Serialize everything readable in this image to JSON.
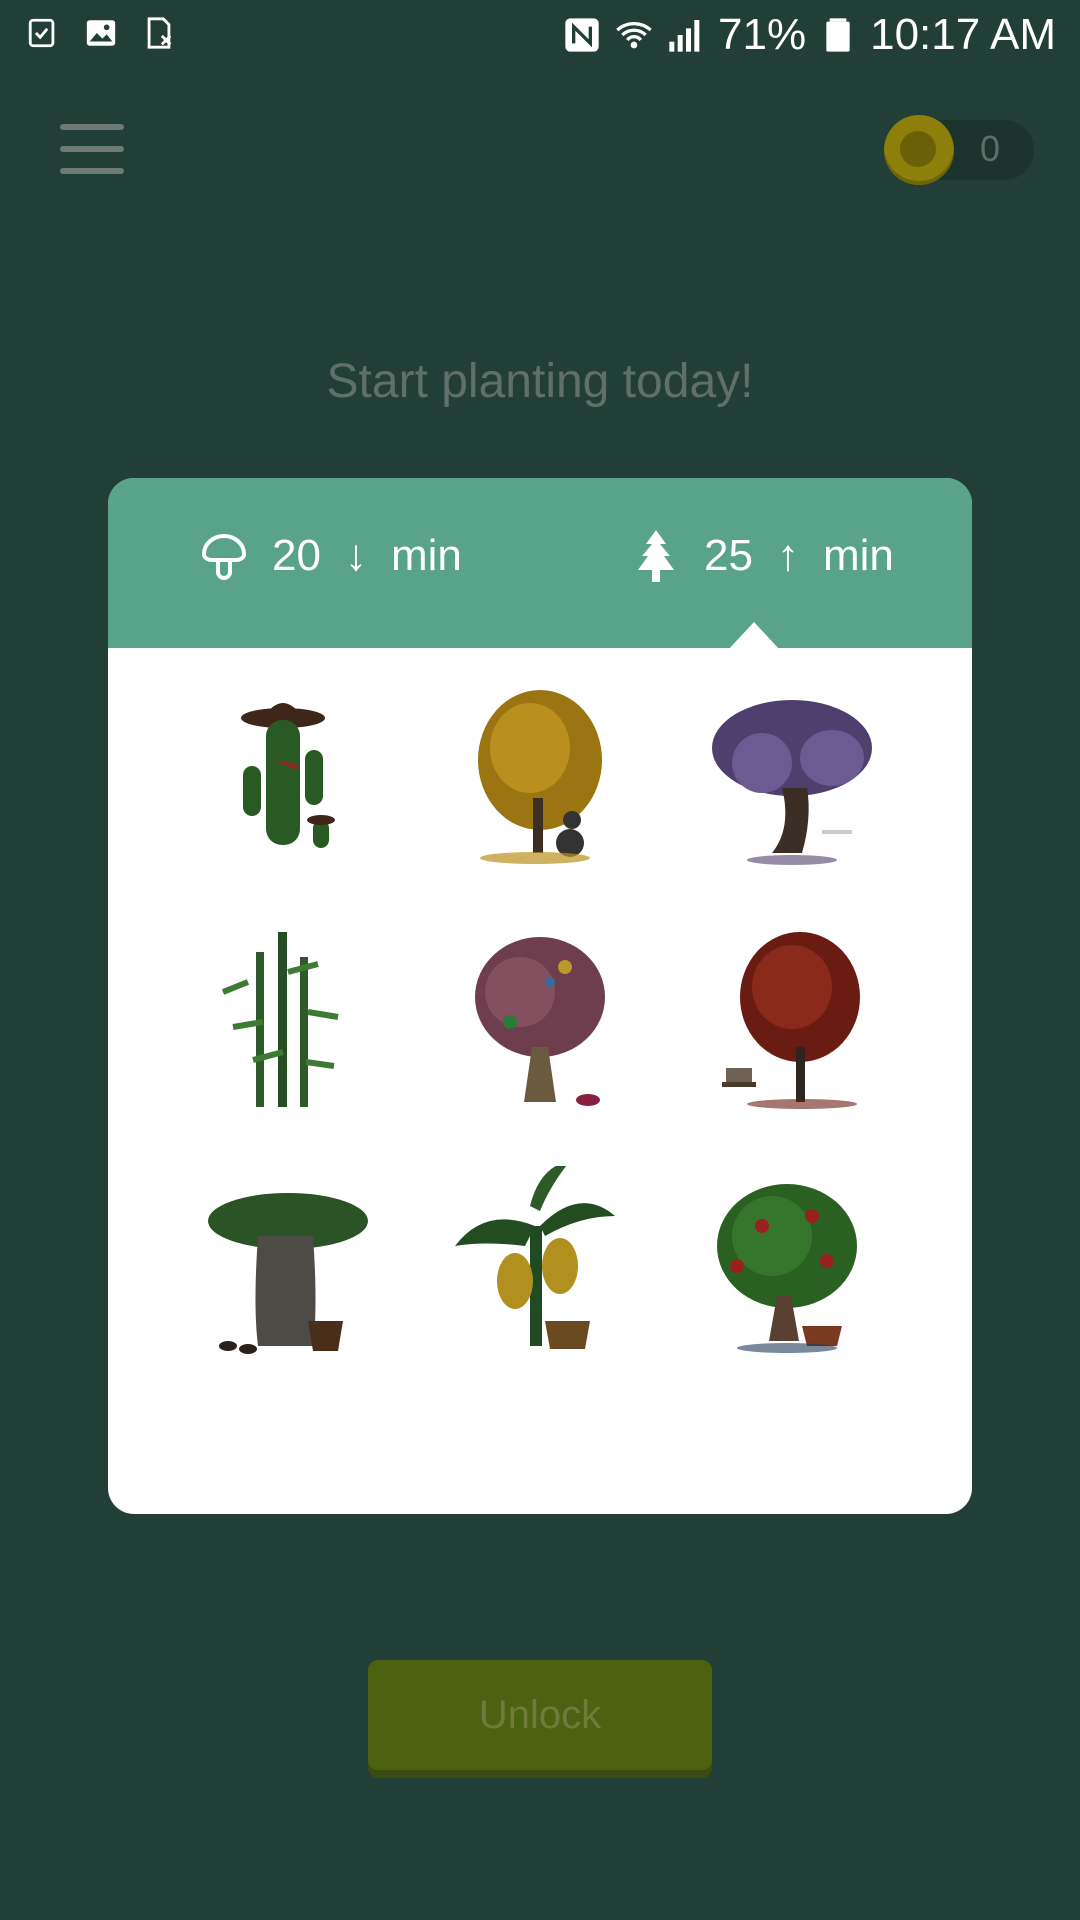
{
  "status_bar": {
    "left_icons": [
      "checklist-icon",
      "image-icon",
      "sim-card-icon"
    ],
    "battery_percent": "71%",
    "time": "10:17 AM"
  },
  "header": {
    "menu_icon": "hamburger-menu-icon",
    "coin_count": "0"
  },
  "headline": "Start planting today!",
  "card": {
    "left_option": {
      "icon": "mushroom-icon",
      "value": "20",
      "arrow": "↓",
      "unit": "min"
    },
    "right_option": {
      "icon": "pine-tree-icon",
      "value": "25",
      "arrow": "↑",
      "unit": "min"
    },
    "trees": [
      "cowboy-cactus",
      "golden-tree-with-dog",
      "wisteria-tree",
      "bamboo",
      "candy-tree",
      "red-maple-tree",
      "baobab-tree",
      "banana-tree",
      "apple-tree"
    ]
  },
  "unlock_button": "Unlock"
}
